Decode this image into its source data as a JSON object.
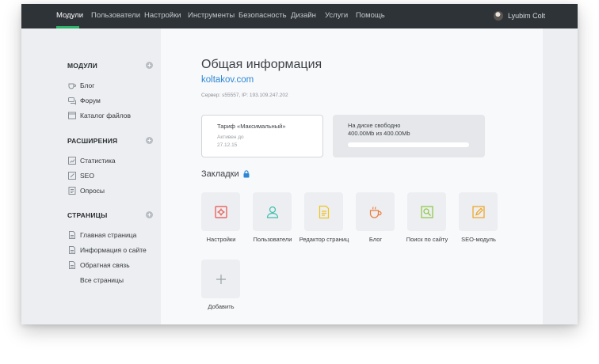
{
  "nav": {
    "items": [
      {
        "label": "Модули",
        "active": true
      },
      {
        "label": "Пользователи"
      },
      {
        "label": "Настройки"
      },
      {
        "label": "Инструменты"
      },
      {
        "label": "Безопасность"
      },
      {
        "label": "Дизайн"
      },
      {
        "label": "Услуги"
      },
      {
        "label": "Помощь"
      }
    ],
    "user_name": "Lyubim Colt"
  },
  "sidebar": {
    "sections": [
      {
        "title": "МОДУЛИ",
        "items": [
          {
            "label": "Блог",
            "icon": "cup-icon"
          },
          {
            "label": "Форум",
            "icon": "chat-icon"
          },
          {
            "label": "Каталог файлов",
            "icon": "folder-icon"
          }
        ]
      },
      {
        "title": "РАСШИРЕНИЯ",
        "items": [
          {
            "label": "Статистика",
            "icon": "chart-icon"
          },
          {
            "label": "SEO",
            "icon": "edit-icon"
          },
          {
            "label": "Опросы",
            "icon": "poll-icon"
          }
        ]
      },
      {
        "title": "СТРАНИЦЫ",
        "items": [
          {
            "label": "Главная страница",
            "icon": "page-icon"
          },
          {
            "label": "Информация о сайте",
            "icon": "page-icon"
          },
          {
            "label": "Обратная связь",
            "icon": "page-icon"
          },
          {
            "label": "Все страницы",
            "icon": ""
          }
        ]
      }
    ]
  },
  "main": {
    "title": "Общая информация",
    "site": "koltakov.com",
    "server_info": "Сервер: s55557, IP: 193.109.247.202",
    "tariff": {
      "name": "Тариф «Максимальный»",
      "sub": "Активен до",
      "date": "27.12.15"
    },
    "disk": {
      "line1": "На диске свободно",
      "line2": "400.00Mb из 400.00Mb",
      "free_fraction": 1.0
    },
    "bookmarks_title": "Закладки",
    "tiles": [
      {
        "label": "Настройки",
        "icon": "settings-icon",
        "color": "#e8504a"
      },
      {
        "label": "Пользователи",
        "icon": "user-icon",
        "color": "#3fbfb0"
      },
      {
        "label": "Редактор страниц",
        "icon": "document-icon",
        "color": "#f2c31c"
      },
      {
        "label": "Блог",
        "icon": "cup-icon",
        "color": "#f07a3a"
      },
      {
        "label": "Поиск по сайту",
        "icon": "search-icon",
        "color": "#8cc63f"
      },
      {
        "label": "SEO-модуль",
        "icon": "edit-icon",
        "color": "#f0a21c"
      },
      {
        "label": "Добавить",
        "icon": "plus-icon",
        "color": "#9aa0a5"
      }
    ]
  },
  "colors": {
    "topbar": "#2e3338",
    "accent_green": "#2fb36a",
    "link_blue": "#2d87d4"
  }
}
